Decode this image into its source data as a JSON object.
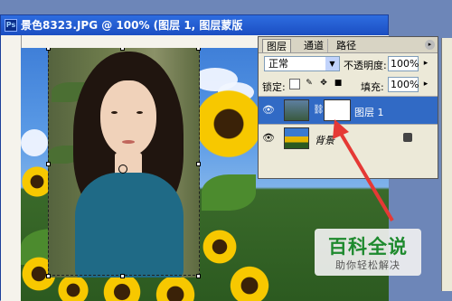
{
  "document": {
    "title": "景色8323.JPG @ 100% (图层 1, 图层蒙版",
    "app_icon": "photoshop-icon"
  },
  "layers_panel": {
    "tabs": [
      "图层",
      "通道",
      "路径"
    ],
    "blend_mode": "正常",
    "opacity_label": "不透明度:",
    "opacity_value": "100%",
    "lock_label": "锁定:",
    "fill_label": "填充:",
    "fill_value": "100%",
    "layers": [
      {
        "name": "图层 1",
        "selected": true,
        "has_mask": true
      },
      {
        "name": "背景",
        "selected": false,
        "locked": true
      }
    ]
  },
  "watermark": {
    "title": "百科全说",
    "subtitle": "助你轻松解决"
  },
  "colors": {
    "selection": "#316ac5",
    "arrow": "#e53935",
    "watermark_green": "#1e8a2e"
  }
}
